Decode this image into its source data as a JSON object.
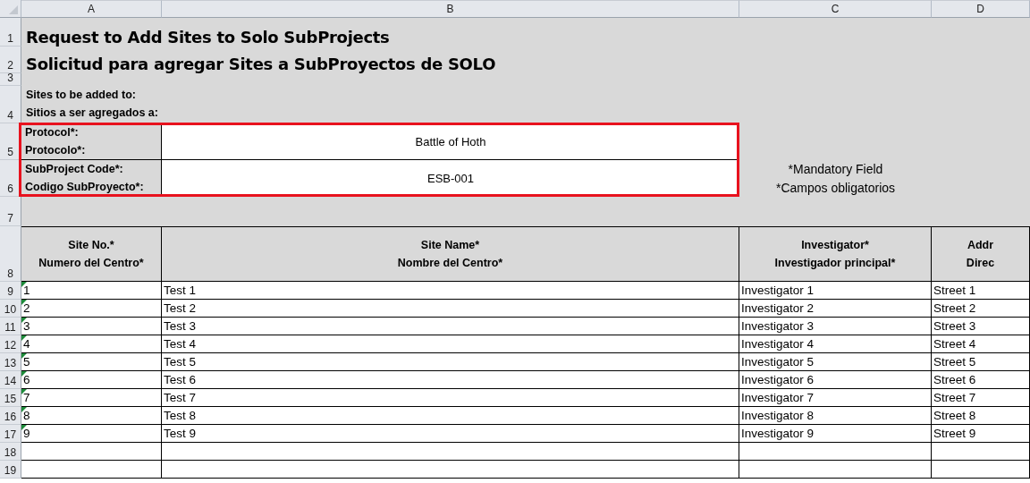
{
  "column_headers": [
    "A",
    "B",
    "C",
    "D"
  ],
  "row_numbers": [
    "1",
    "2",
    "3",
    "4",
    "5",
    "6",
    "7",
    "8",
    "9",
    "10",
    "11",
    "12",
    "13",
    "14",
    "15",
    "16",
    "17",
    "18",
    "19"
  ],
  "title": "Request to Add Sites to Solo SubProjects",
  "subtitle": "Solicitud para agregar Sites a SubProyectos de SOLO",
  "intro": [
    "Sites to be added to:",
    "Sitios a ser agregados a:"
  ],
  "fields": [
    {
      "label": [
        "Protocol*:",
        "Protocolo*:"
      ],
      "value": "Battle of Hoth"
    },
    {
      "label": [
        "SubProject Code*:",
        "Codigo SubProyecto*:"
      ],
      "value": "ESB-001"
    }
  ],
  "fields_highlighted": true,
  "note": [
    "*Mandatory Field",
    "*Campos obligatorios"
  ],
  "table": {
    "columns": [
      {
        "label": [
          "Site No.*",
          "Numero del Centro*"
        ]
      },
      {
        "label": [
          "Site Name*",
          "Nombre del Centro*"
        ]
      },
      {
        "label": [
          "Investigator*",
          "Investigador principal*"
        ]
      },
      {
        "label": [
          "Addr",
          "Direc"
        ]
      }
    ],
    "rows": [
      {
        "cells": [
          "1",
          "Test 1",
          "Investigator 1",
          "Street 1"
        ],
        "flagged": true
      },
      {
        "cells": [
          "2",
          "Test 2",
          "Investigator 2",
          "Street 2"
        ],
        "flagged": true
      },
      {
        "cells": [
          "3",
          "Test 3",
          "Investigator 3",
          "Street 3"
        ],
        "flagged": true
      },
      {
        "cells": [
          "4",
          "Test 4",
          "Investigator 4",
          "Street 4"
        ],
        "flagged": true
      },
      {
        "cells": [
          "5",
          "Test 5",
          "Investigator 5",
          "Street 5"
        ],
        "flagged": true
      },
      {
        "cells": [
          "6",
          "Test 6",
          "Investigator 6",
          "Street 6"
        ],
        "flagged": true
      },
      {
        "cells": [
          "7",
          "Test 7",
          "Investigator 7",
          "Street 7"
        ],
        "flagged": true
      },
      {
        "cells": [
          "8",
          "Test 8",
          "Investigator 8",
          "Street 8"
        ],
        "flagged": true
      },
      {
        "cells": [
          "9",
          "Test 9",
          "Investigator 9",
          "Street 9"
        ],
        "flagged": true
      }
    ]
  }
}
